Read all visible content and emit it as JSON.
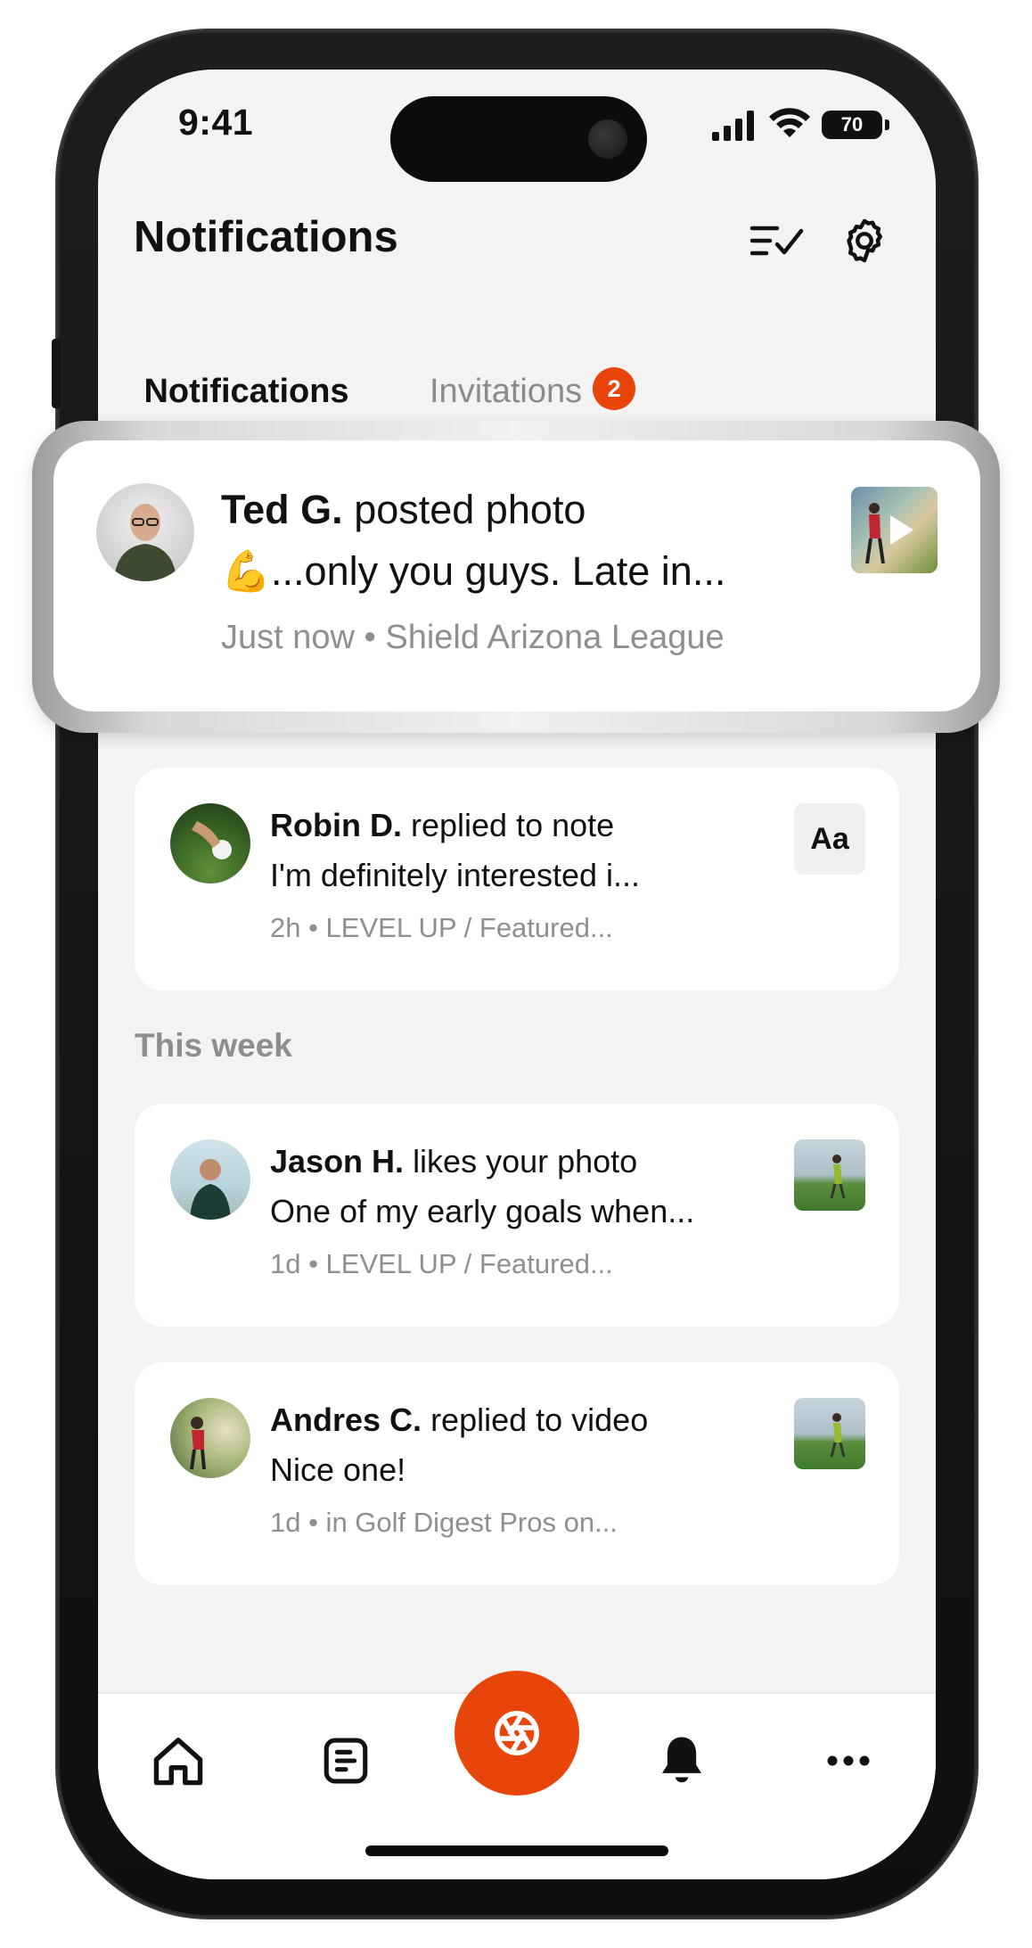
{
  "status_bar": {
    "time": "9:41",
    "battery": "70"
  },
  "header": {
    "title": "Notifications",
    "mark_all_icon": "checklist-icon",
    "settings_icon": "gear-icon"
  },
  "tabs": [
    {
      "label": "Notifications",
      "active": true
    },
    {
      "label": "Invitations",
      "badge": "2",
      "active": false
    }
  ],
  "highlight": {
    "author": "Ted G.",
    "action": "posted photo",
    "preview": "💪...only you guys. Late in...",
    "meta": "Just now • Shield Arizona League",
    "thumb_icon": "play-icon"
  },
  "notifications_today": [
    {
      "author": "Robin D.",
      "action": "replied to note",
      "preview": "I'm definitely interested i...",
      "meta": "2h • LEVEL UP / Featured...",
      "thumb_text": "Aa"
    }
  ],
  "section_week": "This week",
  "notifications_week": [
    {
      "author": "Jason H.",
      "action": "likes your photo",
      "preview": "One of my early goals when...",
      "meta": "1d • LEVEL UP / Featured..."
    },
    {
      "author": "Andres C.",
      "action": "replied to video",
      "preview": "Nice one!",
      "meta": "1d • in Golf Digest Pros on..."
    }
  ],
  "bottom_nav": [
    {
      "icon": "home-icon"
    },
    {
      "icon": "feed-icon"
    },
    {
      "icon": "camera-shutter-icon"
    },
    {
      "icon": "bell-icon"
    },
    {
      "icon": "more-icon"
    }
  ],
  "colors": {
    "accent": "#e8450a",
    "background": "#f3f3f3",
    "card": "#ffffff",
    "muted": "#8f8f8f"
  }
}
